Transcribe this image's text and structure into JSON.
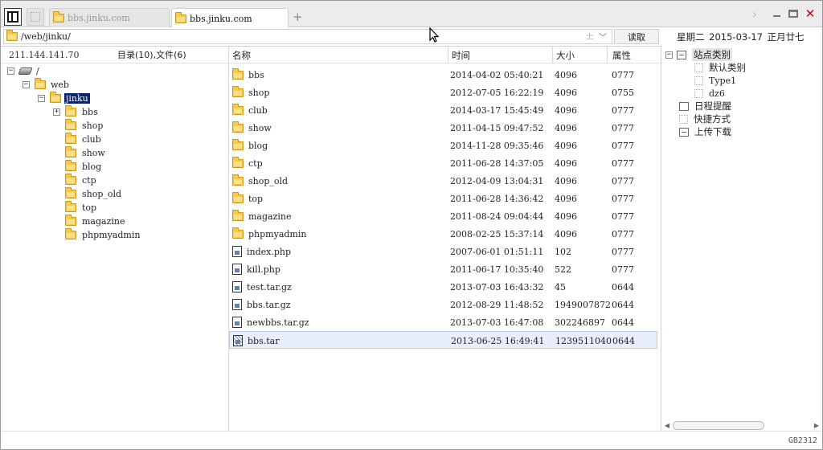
{
  "tabs": [
    {
      "label": "bbs.jinku.com",
      "active": false
    },
    {
      "label": "bbs.jinku.com",
      "active": true
    }
  ],
  "address": {
    "path": "/web/jinku/",
    "read_button": "读取"
  },
  "date": {
    "text": "星期二 2015-03-17 正月廿七"
  },
  "left": {
    "ip": "211.144.141.70",
    "summary": "目录(10),文件(6)",
    "tree": {
      "root": "/",
      "web": "web",
      "selected": "jinku",
      "children": [
        "bbs",
        "shop",
        "club",
        "show",
        "blog",
        "ctp",
        "shop_old",
        "top",
        "magazine",
        "phpmyadmin"
      ]
    }
  },
  "list": {
    "headers": {
      "name": "名称",
      "time": "时间",
      "size": "大小",
      "attr": "属性"
    },
    "rows": [
      {
        "name": "bbs",
        "time": "2014-04-02 05:40:21",
        "size": "4096",
        "attr": "0777",
        "icon": "folder-icon"
      },
      {
        "name": "shop",
        "time": "2012-07-05 16:22:19",
        "size": "4096",
        "attr": "0755",
        "icon": "folder-icon"
      },
      {
        "name": "club",
        "time": "2014-03-17 15:45:49",
        "size": "4096",
        "attr": "0777",
        "icon": "folder-icon"
      },
      {
        "name": "show",
        "time": "2011-04-15 09:47:52",
        "size": "4096",
        "attr": "0777",
        "icon": "folder-icon"
      },
      {
        "name": "blog",
        "time": "2014-11-28 09:35:46",
        "size": "4096",
        "attr": "0777",
        "icon": "folder-icon"
      },
      {
        "name": "ctp",
        "time": "2011-06-28 14:37:05",
        "size": "4096",
        "attr": "0777",
        "icon": "folder-icon"
      },
      {
        "name": "shop_old",
        "time": "2012-04-09 13:04:31",
        "size": "4096",
        "attr": "0777",
        "icon": "folder-icon"
      },
      {
        "name": "top",
        "time": "2011-06-28 14:36:42",
        "size": "4096",
        "attr": "0777",
        "icon": "folder-icon"
      },
      {
        "name": "magazine",
        "time": "2011-08-24 09:04:44",
        "size": "4096",
        "attr": "0777",
        "icon": "folder-icon"
      },
      {
        "name": "phpmyadmin",
        "time": "2008-02-25 15:37:14",
        "size": "4096",
        "attr": "0777",
        "icon": "folder-icon"
      },
      {
        "name": "index.php",
        "time": "2007-06-01 01:51:11",
        "size": "102",
        "attr": "0777",
        "icon": "file-icon"
      },
      {
        "name": "kill.php",
        "time": "2011-06-17 10:35:40",
        "size": "522",
        "attr": "0777",
        "icon": "file-icon"
      },
      {
        "name": "test.tar.gz",
        "time": "2013-07-03 16:43:32",
        "size": "45",
        "attr": "0644",
        "icon": "file-icon"
      },
      {
        "name": "bbs.tar.gz",
        "time": "2012-08-29 11:48:52",
        "size": "1949007872",
        "attr": "0644",
        "icon": "file-icon"
      },
      {
        "name": "newbbs.tar.gz",
        "time": "2013-07-03 16:47:08",
        "size": "302246897",
        "attr": "0644",
        "icon": "file-icon"
      },
      {
        "name": "bbs.tar",
        "time": "2013-06-25 16:49:41",
        "size": "1239511040",
        "attr": "0644",
        "icon": "archive-icon",
        "selected": true
      }
    ]
  },
  "right": {
    "site_category": "站点类别",
    "categories": [
      "默认类别",
      "Type1",
      "dz6"
    ],
    "schedule": "日程提醒",
    "shortcuts": "快捷方式",
    "transfer": "上传下载"
  },
  "status": {
    "encoding": "GB2312"
  },
  "colors": {
    "selection_bg": "#0a246a",
    "close": "#d10000",
    "folder": "#f7c948"
  }
}
